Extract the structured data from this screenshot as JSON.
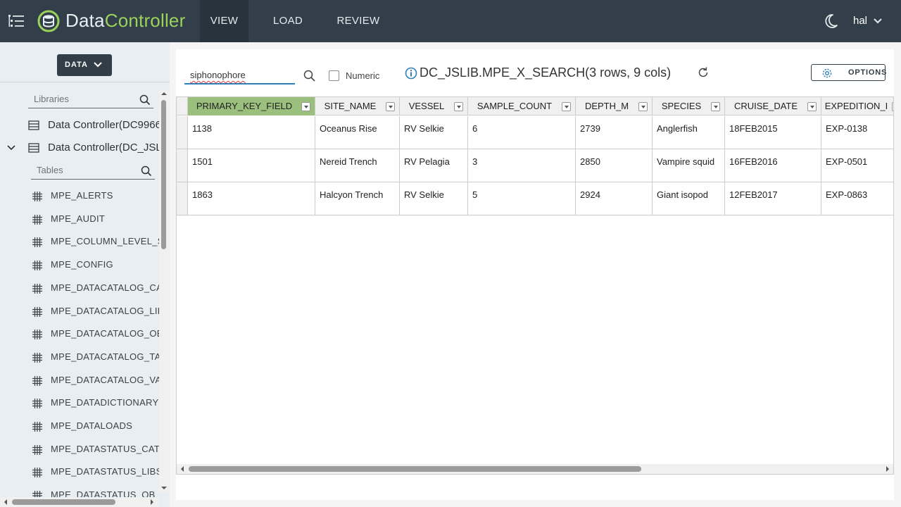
{
  "header": {
    "brand_part1": "Data",
    "brand_part2": "Controller",
    "nav": [
      "VIEW",
      "LOAD",
      "REVIEW"
    ],
    "active_nav": "VIEW",
    "user": "hal",
    "colors": {
      "bar": "#323f4a",
      "brand_accent": "#9bd25a"
    }
  },
  "sidebar": {
    "data_button": "DATA",
    "libraries_placeholder": "Libraries",
    "libraries": [
      {
        "label": "Data Controller(DC9966",
        "expanded": false
      },
      {
        "label": "Data Controller(DC_JSL",
        "expanded": true
      }
    ],
    "tables_placeholder": "Tables",
    "tables": [
      "MPE_ALERTS",
      "MPE_AUDIT",
      "MPE_COLUMN_LEVEL_S",
      "MPE_CONFIG",
      "MPE_DATACATALOG_CA",
      "MPE_DATACATALOG_LIB",
      "MPE_DATACATALOG_OB",
      "MPE_DATACATALOG_TA",
      "MPE_DATACATALOG_VA",
      "MPE_DATADICTIONARY",
      "MPE_DATALOADS",
      "MPE_DATASTATUS_CAT",
      "MPE_DATASTATUS_LIBS",
      "MPE_DATASTATUS_OB"
    ]
  },
  "main": {
    "search_value": "siphonophore",
    "numeric_label": "Numeric",
    "numeric_checked": false,
    "table_title": "DC_JSLIB.MPE_X_SEARCH(3 rows, 9 cols)",
    "options_label": "OPTIONS",
    "columns": [
      "PRIMARY_KEY_FIELD",
      "SITE_NAME",
      "VESSEL",
      "SAMPLE_COUNT",
      "DEPTH_M",
      "SPECIES",
      "CRUISE_DATE",
      "EXPEDITION_I"
    ],
    "selected_column": "PRIMARY_KEY_FIELD",
    "rows": [
      [
        "1138",
        "Oceanus Rise",
        "RV Selkie",
        "6",
        "2739",
        "Anglerfish",
        "18FEB2015",
        "EXP-0138"
      ],
      [
        "1501",
        "Nereid Trench",
        "RV Pelagia",
        "3",
        "2850",
        "Vampire squid",
        "16FEB2016",
        "EXP-0501"
      ],
      [
        "1863",
        "Halcyon Trench",
        "RV Selkie",
        "5",
        "2924",
        "Giant isopod",
        "12FEB2017",
        "EXP-0863"
      ]
    ]
  }
}
